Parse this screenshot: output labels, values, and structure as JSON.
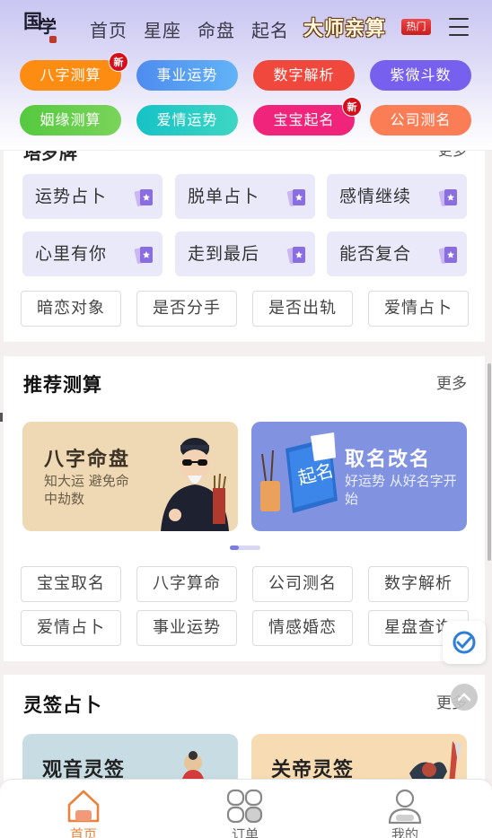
{
  "header": {
    "logo_chars": [
      "国",
      "学"
    ],
    "nav": [
      "首页",
      "星座",
      "命盘",
      "起名"
    ],
    "master_label": "大师亲算",
    "hot_badge": "热门"
  },
  "quick_pills": [
    {
      "label": "八字测算",
      "badge": "新",
      "color": "#fd8c12"
    },
    {
      "label": "事业运势",
      "badge": "",
      "color": "#4f8ff0"
    },
    {
      "label": "数字解析",
      "badge": "",
      "color": "#f1483e"
    },
    {
      "label": "紫微斗数",
      "badge": "",
      "color": "#7860ee"
    },
    {
      "label": "姻缘测算",
      "badge": "",
      "color": "#5fcf48"
    },
    {
      "label": "爱情运势",
      "badge": "",
      "color": "#23c9c4"
    },
    {
      "label": "宝宝起名",
      "badge": "新",
      "color": "#f0247a"
    },
    {
      "label": "公司测名",
      "badge": "",
      "color": "#fb7d55"
    }
  ],
  "tarot_section": {
    "title": "塔罗牌",
    "more": "更多",
    "tiles": [
      "运势占卜",
      "脱单占卜",
      "感情继续",
      "心里有你",
      "走到最后",
      "能否复合"
    ],
    "tags": [
      "暗恋对象",
      "是否分手",
      "是否出轨",
      "爱情占卜"
    ]
  },
  "recommend": {
    "title": "推荐测算",
    "more": "更多",
    "promos": [
      {
        "title": "八字命盘",
        "subtitle": "知大运 避免命中劫数"
      },
      {
        "title": "取名改名",
        "subtitle": "好运势 从好名字开始"
      }
    ],
    "tags": [
      "宝宝取名",
      "八字算命",
      "公司测名",
      "数字解析",
      "爱情占卜",
      "事业运势",
      "情感婚恋",
      "星盘查询"
    ]
  },
  "lottery": {
    "title": "灵签占卜",
    "more": "更多",
    "cards": [
      "观音灵签",
      "关帝灵签"
    ]
  },
  "tabbar": [
    {
      "label": "首页",
      "active": true
    },
    {
      "label": "订单",
      "active": false
    },
    {
      "label": "我的",
      "active": false
    }
  ]
}
